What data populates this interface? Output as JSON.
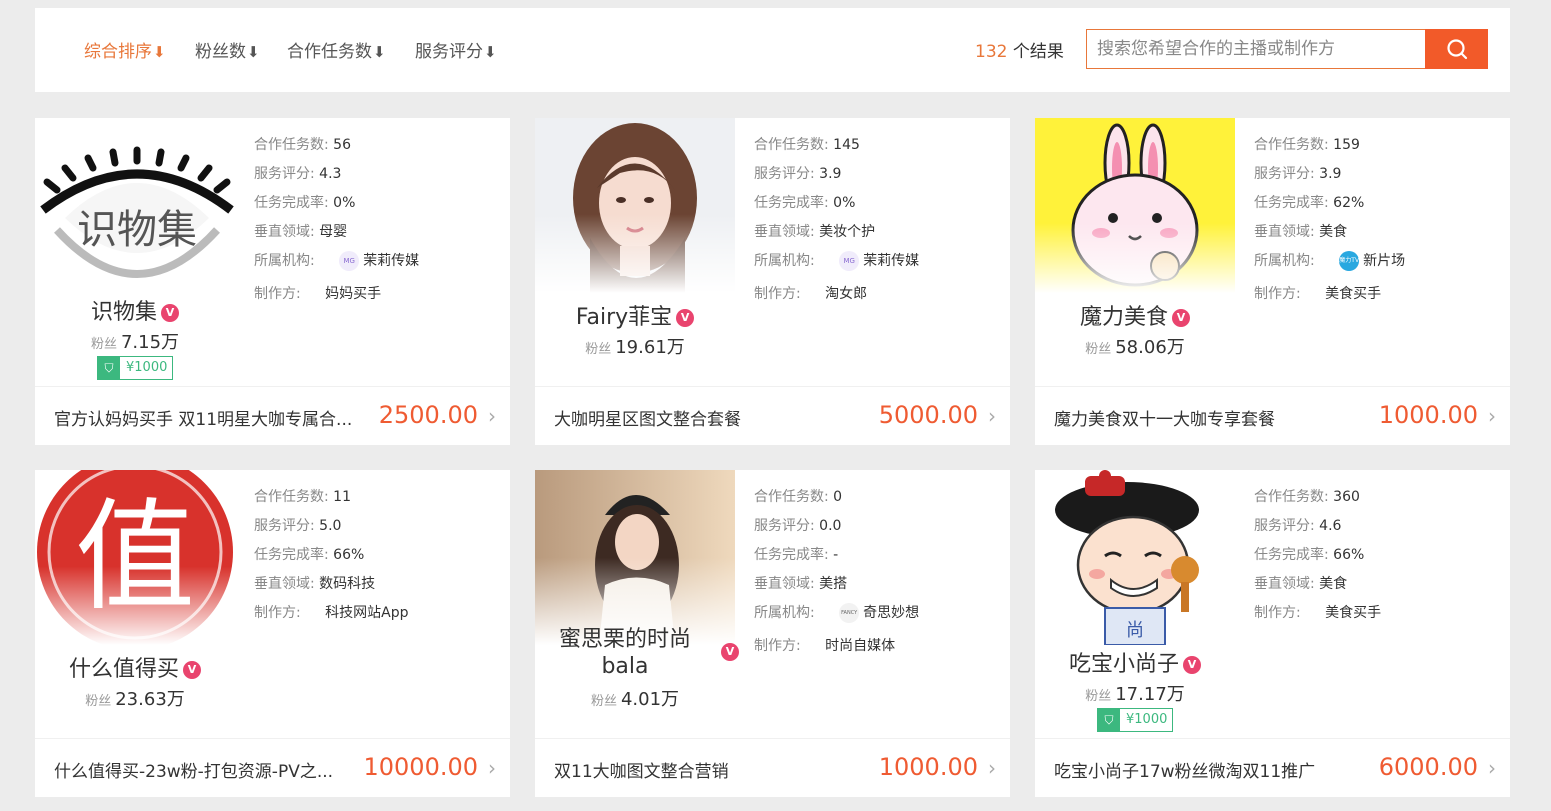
{
  "sort_tabs": [
    {
      "label": "综合排序",
      "arrow": "⬇",
      "active": true
    },
    {
      "label": "粉丝数",
      "arrow": "⬇",
      "active": false
    },
    {
      "label": "合作任务数",
      "arrow": "⬇",
      "active": false
    },
    {
      "label": "服务评分",
      "arrow": "⬇",
      "active": false
    }
  ],
  "results": {
    "count": "132",
    "suffix": " 个结果"
  },
  "search": {
    "placeholder": "搜索您希望合作的主播或制作方",
    "value": ""
  },
  "labels": {
    "tasks": "合作任务数:",
    "score": "服务评分:",
    "completion": "任务完成率:",
    "field": "垂直领域:",
    "agency": "所属机构:",
    "maker": "制作方:",
    "fans": "粉丝",
    "verified_badge": "V"
  },
  "cards": [
    {
      "name": "识物集",
      "fans": "7.15万",
      "price_tag": "¥1000",
      "tasks": "56",
      "score": "4.3",
      "completion": "0%",
      "field": "母婴",
      "agency": "茉莉传媒",
      "agency_logo": "MG",
      "maker": "妈妈买手",
      "package": "官方认妈妈买手 双11明星大咖专属合...",
      "price": "2500.00",
      "avatar": "eye-logo"
    },
    {
      "name": "Fairy菲宝",
      "fans": "19.61万",
      "price_tag": "",
      "tasks": "145",
      "score": "3.9",
      "completion": "0%",
      "field": "美妆个护",
      "agency": "茉莉传媒",
      "agency_logo": "MG",
      "maker": "淘女郎",
      "package": "大咖明星区图文整合套餐",
      "price": "5000.00",
      "avatar": "portrait-woman"
    },
    {
      "name": "魔力美食",
      "fans": "58.06万",
      "price_tag": "",
      "tasks": "159",
      "score": "3.9",
      "completion": "62%",
      "field": "美食",
      "agency": "新片场",
      "agency_logo": "魔力TV",
      "maker": "美食买手",
      "package": "魔力美食双十一大咖专享套餐",
      "price": "1000.00",
      "avatar": "pink-rabbit"
    },
    {
      "name": "什么值得买",
      "fans": "23.63万",
      "price_tag": "",
      "tasks": "11",
      "score": "5.0",
      "completion": "66%",
      "field": "数码科技",
      "agency": "",
      "agency_logo": "",
      "maker": "科技网站App",
      "package": "什么值得买-23w粉-打包资源-PV之...",
      "price": "10000.00",
      "avatar": "zhi-seal"
    },
    {
      "name": "蜜思栗的时尚bala",
      "fans": "4.01万",
      "price_tag": "",
      "tasks": "0",
      "score": "0.0",
      "completion": "-",
      "field": "美搭",
      "agency": "奇思妙想",
      "agency_logo": "FANCY",
      "maker": "时尚自媒体",
      "package": "双11大咖图文整合营销",
      "price": "1000.00",
      "avatar": "portrait-girl"
    },
    {
      "name": "吃宝小尚子",
      "fans": "17.17万",
      "price_tag": "¥1000",
      "tasks": "360",
      "score": "4.6",
      "completion": "66%",
      "field": "美食",
      "agency": "",
      "agency_logo": "",
      "maker": "美食买手",
      "package": "吃宝小尚子17w粉丝微淘双11推广",
      "price": "6000.00",
      "avatar": "cartoon-official"
    }
  ],
  "colors": {
    "accent": "#e8773a",
    "search_button": "#f25a29",
    "price": "#ef5b32",
    "verified": "#e9446e",
    "tag": "#3cb87f"
  }
}
